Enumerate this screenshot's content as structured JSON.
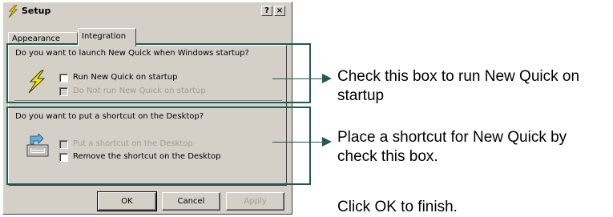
{
  "window": {
    "title": "Setup",
    "help_label": "?",
    "close_label": "×"
  },
  "tabs": [
    {
      "label": "Appearance",
      "selected": false
    },
    {
      "label": "Integration",
      "selected": true
    }
  ],
  "startup": {
    "question": "Do you want to launch New Quick when Windows startup?",
    "icon": "lightning-bolt-icon",
    "options": [
      {
        "label": "Run New Quick on startup",
        "checked": false,
        "enabled": true
      },
      {
        "label": "Do Not run New Quick on startup",
        "checked": false,
        "enabled": false
      }
    ]
  },
  "desktop": {
    "question": "Do you want to put a shortcut on the Desktop?",
    "icon": "desktop-shortcut-icon",
    "options": [
      {
        "label": "Put a shortcut on the Desktop",
        "checked": false,
        "enabled": false
      },
      {
        "label": "Remove the shortcut on the Desktop",
        "checked": false,
        "enabled": true
      }
    ]
  },
  "buttons": {
    "ok": "OK",
    "cancel": "Cancel",
    "apply": "Apply"
  },
  "annotations": {
    "startup_note": "Check this box to run New Quick on startup",
    "shortcut_note": "Place a shortcut for New Quick by check this box.",
    "finish_note": "Click OK to finish."
  },
  "colors": {
    "dialog_bg": "#d4d0c8",
    "highlight_box": "#1f5a55",
    "disabled_text": "#a09c94"
  }
}
